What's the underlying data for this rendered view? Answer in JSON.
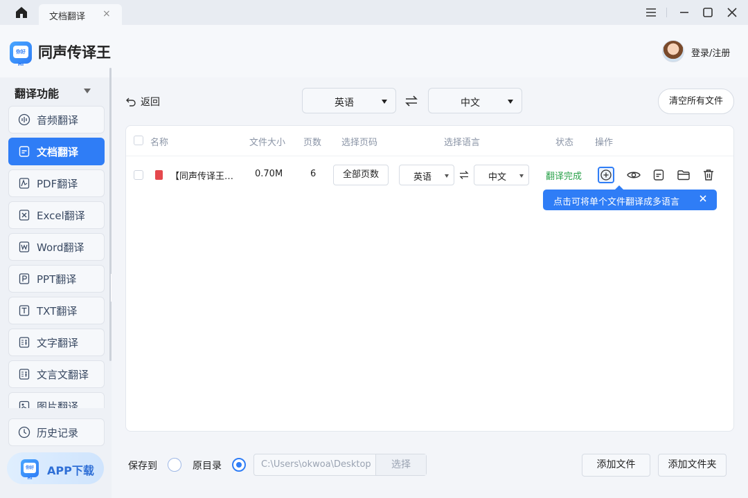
{
  "titlebar": {
    "tab_label": "文档翻译",
    "tab_close": "×"
  },
  "header": {
    "app_title": "同声传译王",
    "logo_text": "你好Hi",
    "login": "登录/注册"
  },
  "sidebar": {
    "heading": "翻译功能",
    "items": [
      {
        "label": "音频翻译",
        "icon": "audio-icon",
        "active": false
      },
      {
        "label": "文档翻译",
        "icon": "document-icon",
        "active": true
      },
      {
        "label": "PDF翻译",
        "icon": "pdf-icon",
        "active": false
      },
      {
        "label": "Excel翻译",
        "icon": "excel-icon",
        "active": false
      },
      {
        "label": "Word翻译",
        "icon": "word-icon",
        "active": false
      },
      {
        "label": "PPT翻译",
        "icon": "ppt-icon",
        "active": false
      },
      {
        "label": "TXT翻译",
        "icon": "txt-icon",
        "active": false
      },
      {
        "label": "文字翻译",
        "icon": "text-icon",
        "active": false
      },
      {
        "label": "文言文翻译",
        "icon": "classical-icon",
        "active": false
      },
      {
        "label": "图片翻译",
        "icon": "image-icon",
        "active": false
      }
    ],
    "history": "历史记录",
    "app_download": "APP下载"
  },
  "toolbar": {
    "back": "返回",
    "source_lang": "英语",
    "target_lang": "中文",
    "clear_all": "清空所有文件"
  },
  "table": {
    "headers": {
      "name": "名称",
      "size": "文件大小",
      "pages": "页数",
      "page_select": "选择页码",
      "lang_select": "选择语言",
      "status": "状态",
      "action": "操作"
    },
    "rows": [
      {
        "name": "【同声传译王使用说明】.pdf",
        "size": "0.70M",
        "pages": "6",
        "page_range": "全部页数",
        "source_lang": "英语",
        "target_lang": "中文",
        "status": "翻译完成"
      }
    ]
  },
  "tooltip": {
    "text": "点击可将单个文件翻译成多语言"
  },
  "bottom": {
    "save_to": "保存到",
    "original_dir": "原目录",
    "path": "C:\\Users\\okwoa\\Desktop",
    "choose": "选择",
    "add_file": "添加文件",
    "add_folder": "添加文件夹"
  },
  "colors": {
    "accent": "#2f7df6",
    "status_done": "#2aa24a",
    "pdf_red": "#e5484d"
  }
}
